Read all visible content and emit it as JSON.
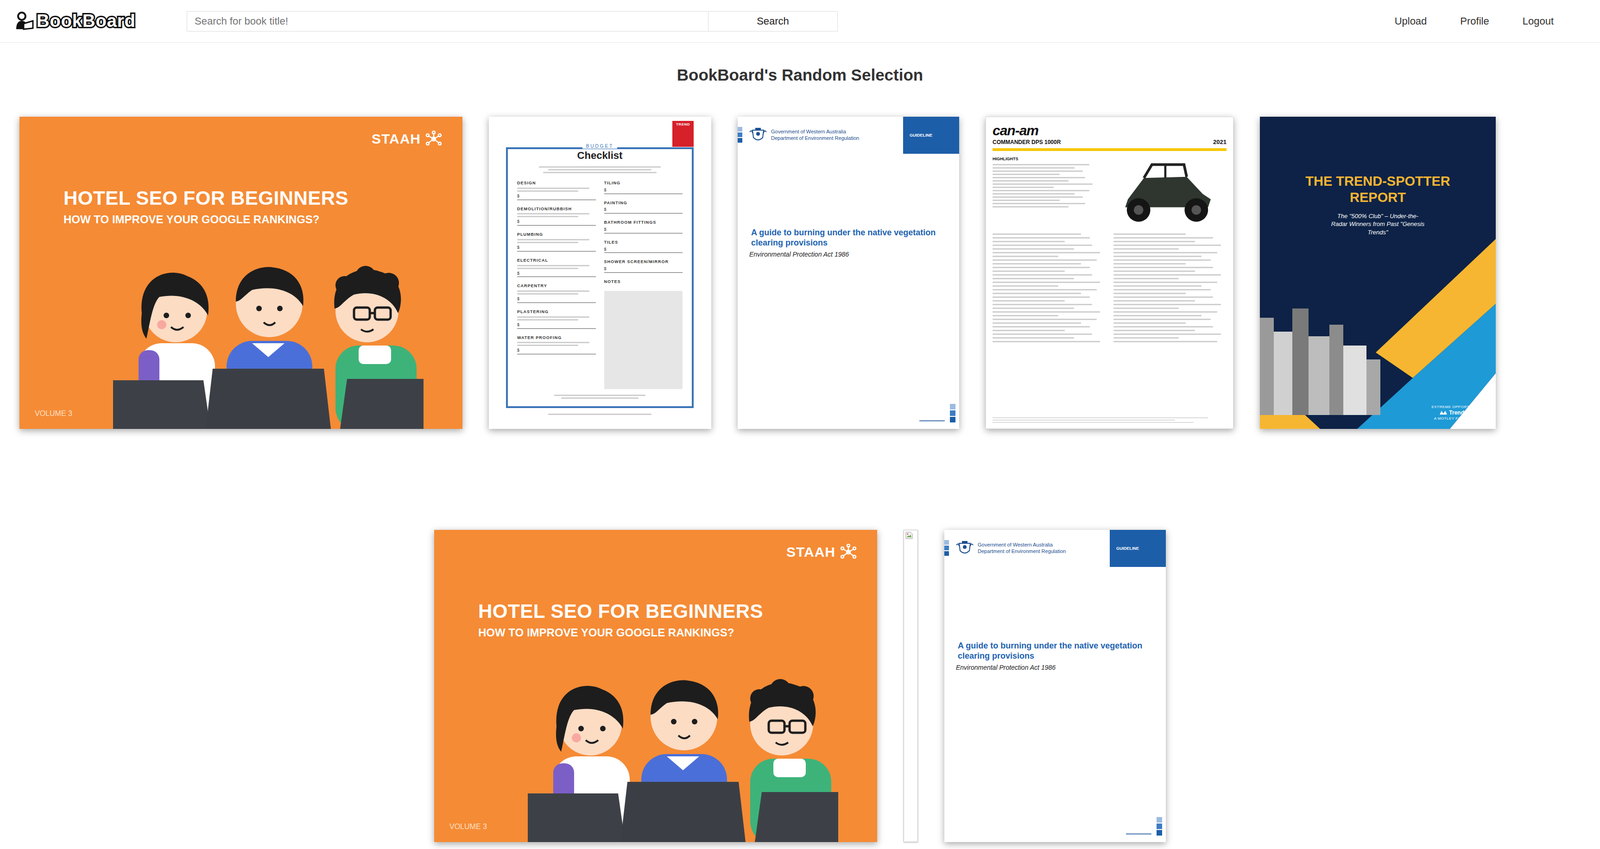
{
  "header": {
    "logo": "BookBoard",
    "search": {
      "placeholder": "Search for book title!",
      "button": "Search"
    },
    "nav": [
      "Upload",
      "Profile",
      "Logout"
    ]
  },
  "title": "BookBoard's Random Selection",
  "rows": [
    {
      "books": [
        {
          "kind": "staah",
          "brand": "STAAH",
          "title": "HOTEL SEO FOR BEGINNERS",
          "subtitle": "HOW TO IMPROVE YOUR GOOGLE RANKINGS?",
          "volume": "VOLUME 3"
        },
        {
          "kind": "checklist",
          "badge": "TREND",
          "eyebrow": "BUDGET",
          "title": "Checklist",
          "currency": "$",
          "notes": "NOTES",
          "left": [
            {
              "label": "DESIGN"
            },
            {
              "label": "DEMOLITION/RUBBISH"
            },
            {
              "label": "PLUMBING"
            },
            {
              "label": "ELECTRICAL"
            },
            {
              "label": "CARPENTRY"
            },
            {
              "label": "PLASTERING"
            },
            {
              "label": "WATER PROOFING"
            }
          ],
          "right": [
            {
              "label": "TILING"
            },
            {
              "label": "PAINTING"
            },
            {
              "label": "BATHROOM FITTINGS"
            },
            {
              "label": "TILES"
            },
            {
              "label": "SHOWER SCREEN/MIRROR"
            }
          ]
        },
        {
          "kind": "guideline",
          "gov": "Government of Western Australia",
          "dept": "Department of Environment Regulation",
          "tag": "GUIDELINE",
          "title": "A guide to burning under the native vegetation clearing provisions",
          "subtitle": "Environmental Protection Act 1986"
        },
        {
          "kind": "spec",
          "brand": "can-am",
          "model": "COMMANDER DPS 1000R",
          "year": "2021",
          "section": "HIGHLIGHTS"
        },
        {
          "kind": "report",
          "title": "THE TREND-SPOTTER REPORT",
          "subtitle": "The \"500% Club\" – Under-the-Radar Winners from Past \"Genesis Trends\"",
          "eyebrow": "EXTREME OPPORTUNITIES",
          "brand": "Trend-Spotter",
          "footer": "A MOTLEY FOOL SERVICE"
        }
      ]
    },
    {
      "books": [
        {
          "kind": "staah",
          "brand": "STAAH",
          "title": "HOTEL SEO FOR BEGINNERS",
          "subtitle": "HOW TO IMPROVE YOUR GOOGLE RANKINGS?",
          "volume": "VOLUME 3"
        },
        {
          "kind": "broken"
        },
        {
          "kind": "guideline",
          "gov": "Government of Western Australia",
          "dept": "Department of Environment Regulation",
          "tag": "GUIDELINE",
          "title": "A guide to burning under the native vegetation clearing provisions",
          "subtitle": "Environmental Protection Act 1986"
        }
      ]
    }
  ]
}
